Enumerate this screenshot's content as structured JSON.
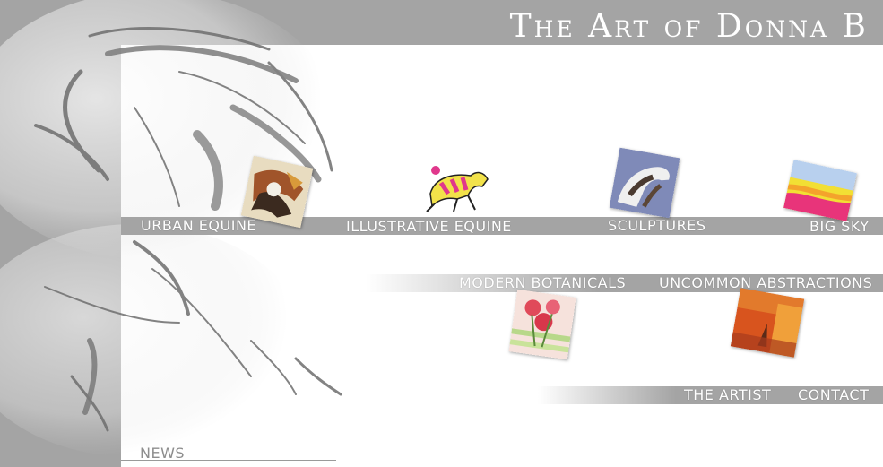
{
  "header": {
    "title": "The Art of Donna B"
  },
  "nav": {
    "urban_equine": "URBAN EQUINE",
    "illustrative_equine": "ILLUSTRATIVE EQUINE",
    "sculptures": "SCULPTURES",
    "big_sky": "BIG SKY",
    "modern_botanicals": "MODERN BOTANICALS",
    "uncommon_abstractions": "UNCOMMON ABSTRACTIONS",
    "the_artist": "THE ARTIST",
    "contact": "CONTACT",
    "news": "NEWS"
  },
  "colors": {
    "background": "#a4a4a4",
    "panel": "#ffffff",
    "text": "#ffffff",
    "news": "#8e8e8e"
  }
}
